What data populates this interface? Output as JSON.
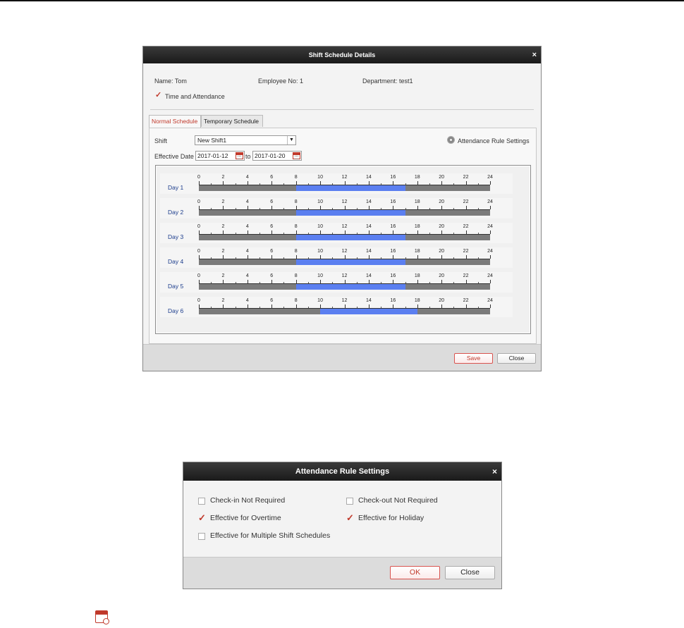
{
  "shift_dialog": {
    "title": "Shift Schedule Details",
    "close_glyph": "×",
    "name": "Name: Tom",
    "employee_no": "Employee No: 1",
    "department": "Department: test1",
    "time_attendance_label": "Time and Attendance",
    "time_attendance_checked": true,
    "tabs": [
      {
        "label": "Normal Schedule",
        "active": true
      },
      {
        "label": "Temporary Schedule",
        "active": false
      }
    ],
    "shift_label": "Shift",
    "shift_value": "New Shift1",
    "attendance_rule_link": "Attendance Rule Settings",
    "effective_date_label": "Effective Date",
    "date_from": "2017-01-12",
    "date_to_label": "to",
    "date_to": "2017-01-20",
    "hour_labels": [
      "0",
      "2",
      "4",
      "6",
      "8",
      "10",
      "12",
      "14",
      "16",
      "18",
      "20",
      "22",
      "24"
    ],
    "days": [
      {
        "label": "Day 1",
        "start": 8,
        "end": 17
      },
      {
        "label": "Day 2",
        "start": 8,
        "end": 17
      },
      {
        "label": "Day 3",
        "start": 8,
        "end": 17
      },
      {
        "label": "Day 4",
        "start": 8,
        "end": 17
      },
      {
        "label": "Day 5",
        "start": 8,
        "end": 17
      },
      {
        "label": "Day 6",
        "start": 10,
        "end": 18
      }
    ],
    "save_label": "Save",
    "close_label": "Close"
  },
  "rule_dialog": {
    "title": "Attendance Rule Settings",
    "close_glyph": "×",
    "options": [
      {
        "label": "Check-in Not Required",
        "checked": false
      },
      {
        "label": "Check-out Not Required",
        "checked": false
      },
      {
        "label": "Effective for Overtime",
        "checked": true
      },
      {
        "label": "Effective for Holiday",
        "checked": true
      },
      {
        "label": "Effective for Multiple Shift Schedules",
        "checked": false
      }
    ],
    "ok_label": "OK",
    "close_label": "Close"
  },
  "colors": {
    "accent": "#c0392b",
    "schedule_bar": "#5b7ff0",
    "track": "#7b7b7b",
    "day_label": "#1b3c8c"
  }
}
